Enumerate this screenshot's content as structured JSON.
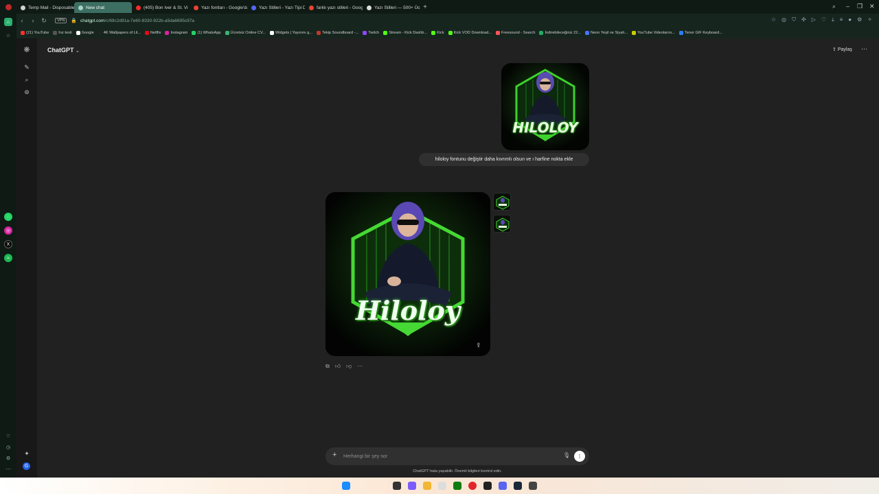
{
  "browser": {
    "tabs": [
      {
        "label": "Temp Mail - Disposable T",
        "fav": "#d1d1d1"
      },
      {
        "label": "New chat",
        "fav": "#a8d0c4",
        "active": true
      },
      {
        "label": "(405) Bon Iver & St. Vi",
        "fav": "#ff2a2a"
      },
      {
        "label": "Yazı fontları - Google'da A",
        "fav": "#ea4335"
      },
      {
        "label": "Yazı Stilleri - Yazı Tipi Değ",
        "fav": "#5566ff"
      },
      {
        "label": "farklı yazı stilleri - Google",
        "fav": "#ea4335"
      },
      {
        "label": "Yazı Stilleri — 500+ Ücret",
        "fav": "#dddddd"
      }
    ],
    "new_tab_icon": "+",
    "url_main": "chatgpt.com",
    "url_rest": "/c/69c2d91a-7e60-8330-922b-a5da6695c97a",
    "vpn_label": "VPN",
    "bookmarks": [
      {
        "label": "(21) YouTube",
        "color": "#ff3030"
      },
      {
        "label": "hız testi",
        "color": "#555555"
      },
      {
        "label": "Google",
        "color": "#ffffff"
      },
      {
        "label": "4K Wallpapers of Lil...",
        "color": "#222222"
      },
      {
        "label": "Netflix",
        "color": "#e50914"
      },
      {
        "label": "Instagram",
        "color": "#d6249f"
      },
      {
        "label": "(1) WhatsApp",
        "color": "#25d366"
      },
      {
        "label": "Ücretsiz Online CV...",
        "color": "#3cb371"
      },
      {
        "label": "Widgets | Yayınını g...",
        "color": "#ffffff"
      },
      {
        "label": "Tekip Soundboard -...",
        "color": "#c0392b"
      },
      {
        "label": "Twitch",
        "color": "#9146ff"
      },
      {
        "label": "Stream - Kick Dashb...",
        "color": "#53fc18"
      },
      {
        "label": "Kick",
        "color": "#53fc18"
      },
      {
        "label": "Kick VOD Download...",
        "color": "#53fc18"
      },
      {
        "label": "Freesound - Search",
        "color": "#ff5555"
      },
      {
        "label": "İndirebileceğiniz 22...",
        "color": "#22aa66"
      },
      {
        "label": "Neon Yeşil ve Siyah...",
        "color": "#4477ff"
      },
      {
        "label": "YouTube Videolarını...",
        "color": "#cccc00"
      },
      {
        "label": "Tenor GIF Keyboard...",
        "color": "#2a7fff"
      }
    ]
  },
  "chatgpt": {
    "title": "ChatGPT",
    "share_label": "Paylaş",
    "user_message": "hiloloy fontunu değiştir daha kıvrımlı olsun ve ı harfine nokta ekle",
    "first_image_text": "HILOLOY",
    "second_image_text": "Hiloloy",
    "composer_placeholder": "Herhangi bir şey sor",
    "disclaimer": "ChatGPT hata yapabilir. Önemli bilgileri kontrol edin.",
    "colors": {
      "accent": "#3fd12d",
      "background": "#212121",
      "bubble": "#303030"
    }
  }
}
